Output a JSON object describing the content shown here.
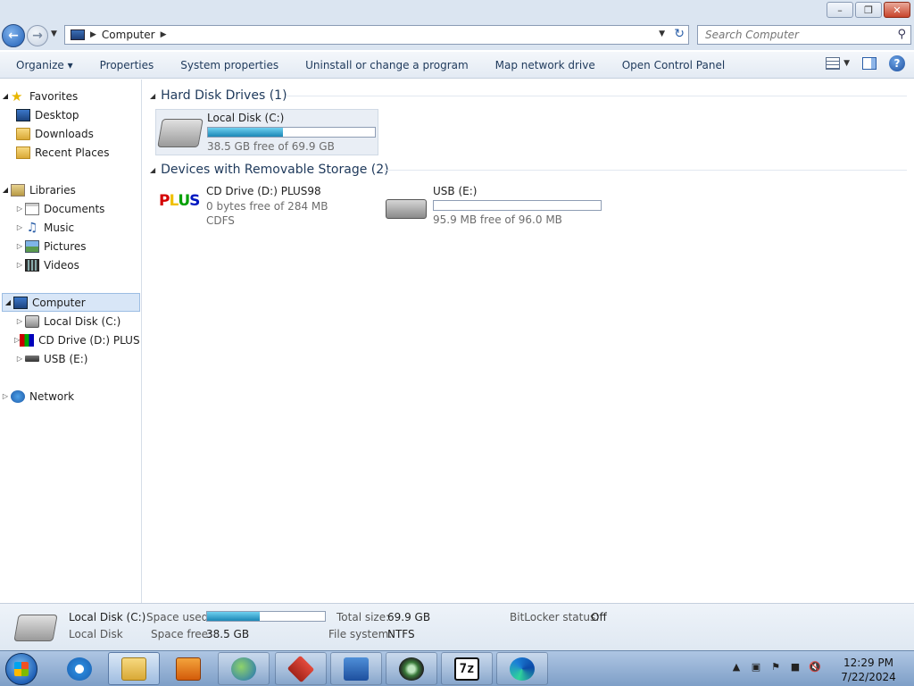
{
  "address": {
    "breadcrumb": [
      "Computer"
    ],
    "search_placeholder": "Search Computer"
  },
  "toolbar": {
    "items": [
      "Organize",
      "Properties",
      "System properties",
      "Uninstall or change a program",
      "Map network drive",
      "Open Control Panel"
    ],
    "organize_caret": "▾"
  },
  "nav": {
    "favorites": "Favorites",
    "desktop": "Desktop",
    "downloads": "Downloads",
    "recent_places": "Recent Places",
    "libraries": "Libraries",
    "documents": "Documents",
    "music": "Music",
    "pictures": "Pictures",
    "videos": "Videos",
    "computer": "Computer",
    "local_disk": "Local Disk (C:)",
    "cd_drive": "CD Drive (D:) PLUS98",
    "usb": "USB (E:)",
    "network": "Network"
  },
  "groups": {
    "hard_disk": {
      "title": "Hard Disk Drives (1)",
      "drives": [
        {
          "name": "Local Disk (C:)",
          "free_text": "38.5 GB free of 69.9 GB",
          "used_fraction": 0.449
        }
      ]
    },
    "removable": {
      "title": "Devices with Removable Storage (2)",
      "drives": [
        {
          "name": "CD Drive (D:) PLUS98",
          "free_text": "0 bytes free of 284 MB",
          "fs": "CDFS"
        },
        {
          "name": "USB (E:)",
          "free_text": "95.9 MB free of 96.0 MB",
          "used_fraction": 0.001
        }
      ]
    }
  },
  "details": {
    "name": "Local Disk (C:)",
    "type": "Local Disk",
    "space_used_label": "Space used:",
    "used_fraction": 0.449,
    "space_free_label": "Space free:",
    "space_free": "38.5 GB",
    "total_size_label": "Total size:",
    "total_size": "69.9 GB",
    "file_system_label": "File system:",
    "file_system": "NTFS",
    "bitlocker_label": "BitLocker status:",
    "bitlocker": "Off"
  },
  "taskbar": {
    "time": "12:29 PM",
    "date": "7/22/2024",
    "sevenzip_label": "7z"
  },
  "colors": {
    "bar_fill": "#1c87b5",
    "selection": "#d8e6f7",
    "header_text": "#1e395b"
  }
}
